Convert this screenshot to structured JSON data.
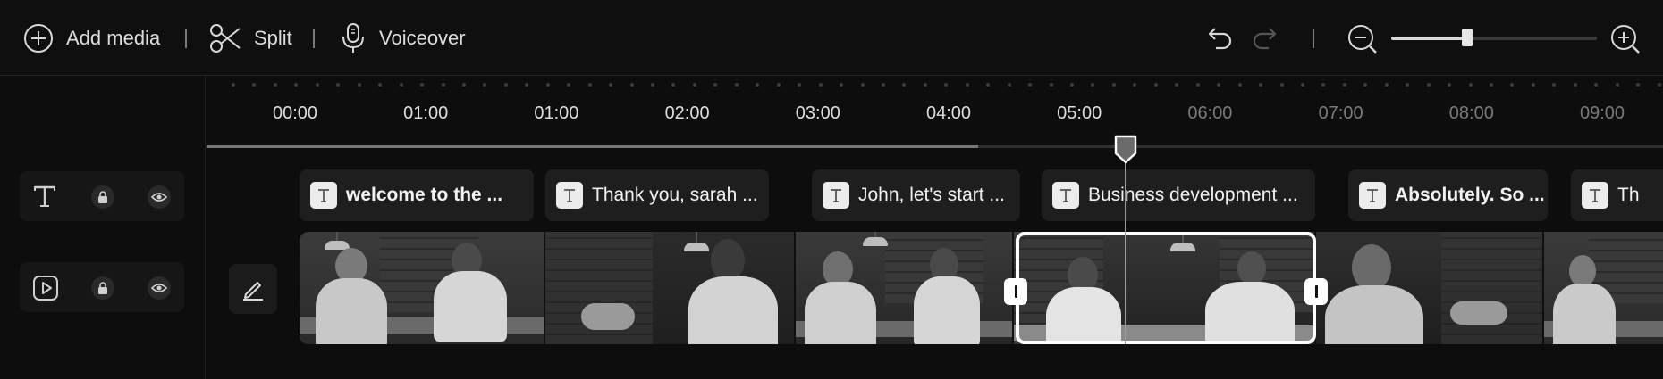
{
  "toolbar": {
    "add_media_label": "Add media",
    "split_label": "Split",
    "voiceover_label": "Voiceover",
    "zoom_level": 0.37
  },
  "ruler": {
    "labels": [
      "00:00",
      "01:00",
      "01:00",
      "02:00",
      "03:00",
      "04:00",
      "05:00",
      "06:00",
      "07:00",
      "08:00",
      "09:00"
    ]
  },
  "playhead": {
    "time_fraction": 0.53
  },
  "text_track": {
    "clips": [
      {
        "text": "welcome to the ...",
        "bold": true
      },
      {
        "text": "Thank you, sarah ...",
        "bold": false
      },
      {
        "text": "John, let's start ...",
        "bold": false
      },
      {
        "text": "Business development ...",
        "bold": false
      },
      {
        "text": "Absolutely. So ...",
        "bold": true
      },
      {
        "text": "Th",
        "bold": false
      }
    ]
  },
  "tracks": {
    "text_track_icon": "text-icon",
    "video_track_icon": "video-icon",
    "lock_icon": "lock-icon",
    "visibility_icon": "eye-icon"
  },
  "colors": {
    "background": "#0d0d0d",
    "panel": "#1e1e1e",
    "selection": "#ffffff",
    "playhead": "#6b6b6b"
  }
}
